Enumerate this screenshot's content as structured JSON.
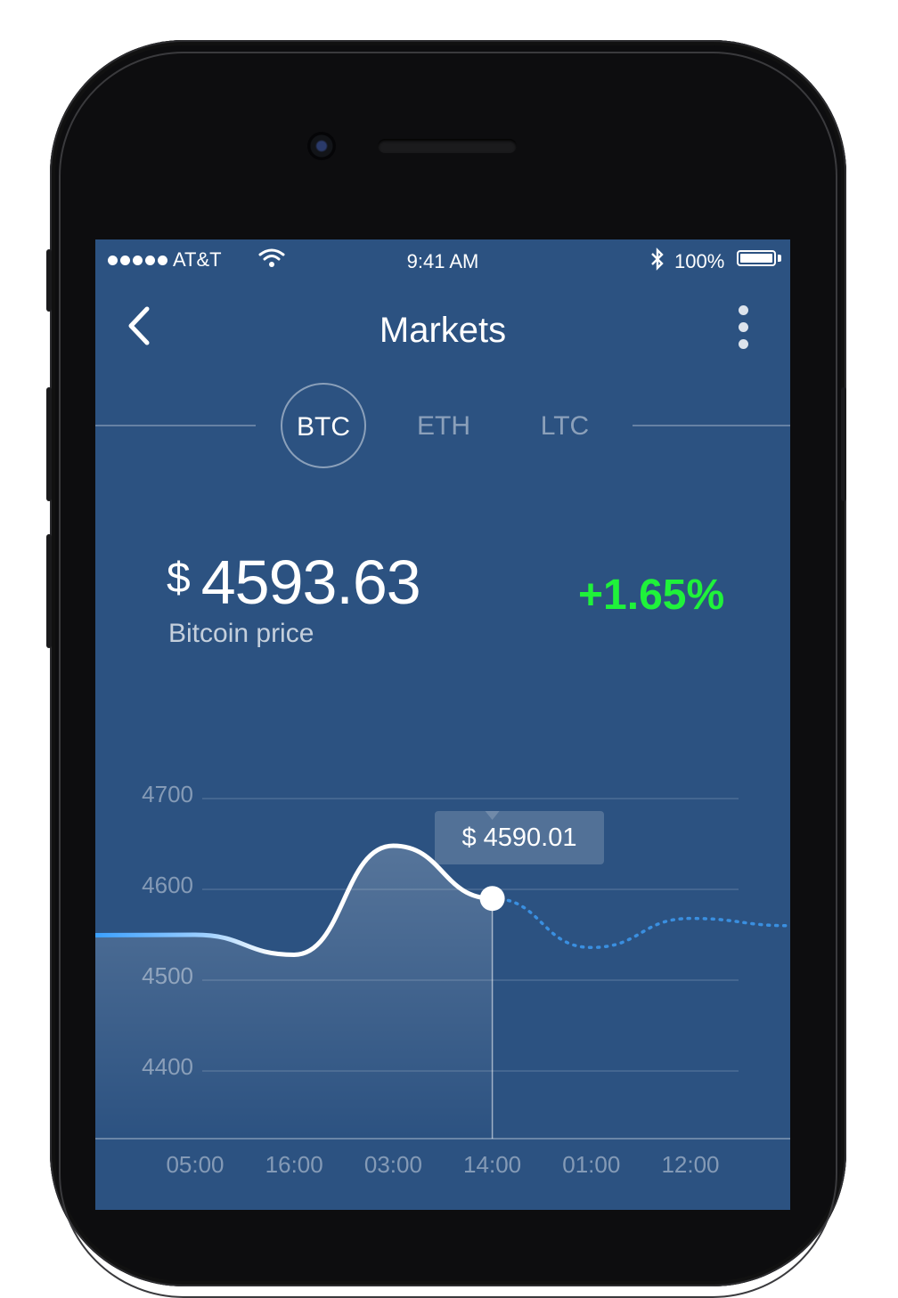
{
  "status_bar": {
    "carrier": "AT&T",
    "time": "9:41 AM",
    "battery": "100%"
  },
  "header": {
    "title": "Markets"
  },
  "tabs": [
    {
      "label": "BTC",
      "active": true
    },
    {
      "label": "ETH",
      "active": false
    },
    {
      "label": "LTC",
      "active": false
    }
  ],
  "price": {
    "currency": "$",
    "value": "4593.63",
    "label": "Bitcoin price",
    "change": "+1.65%",
    "change_color": "#1ff23a"
  },
  "tooltip": {
    "text": "$ 4590.01"
  },
  "colors": {
    "background": "#2c5281",
    "line": "#ffffff",
    "line_start": "#3aa0ff"
  },
  "chart_data": {
    "type": "line",
    "x_labels": [
      "05:00",
      "16:00",
      "03:00",
      "14:00",
      "01:00",
      "12:00"
    ],
    "y_ticks": [
      4700,
      4600,
      4500,
      4400
    ],
    "ylim": [
      4320,
      4700
    ],
    "series": [
      {
        "style": "solid",
        "points": [
          {
            "x": "05:00",
            "y": 4550
          },
          {
            "x": "16:00",
            "y": 4528
          },
          {
            "x": "03:00",
            "y": 4648
          },
          {
            "x": "14:00",
            "y": 4590
          }
        ]
      },
      {
        "style": "dotted",
        "points": [
          {
            "x": "14:00",
            "y": 4590
          },
          {
            "x": "01:00",
            "y": 4536
          },
          {
            "x": "12:00",
            "y": 4568
          }
        ]
      }
    ],
    "highlight": {
      "x": "14:00",
      "y": 4590.01
    }
  }
}
